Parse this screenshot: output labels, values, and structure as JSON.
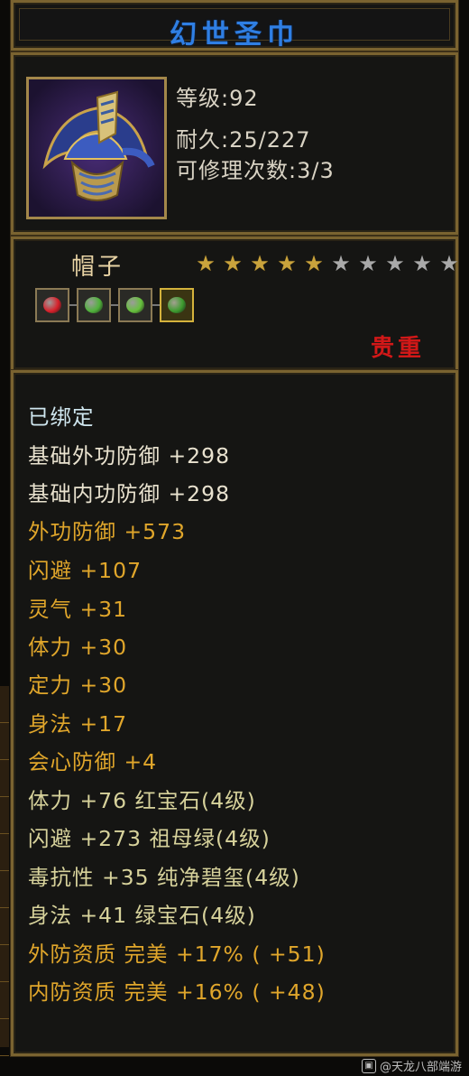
{
  "title": "幻世圣巾",
  "header": {
    "level": "等级:92",
    "durability": "耐久:25/227",
    "repair": "可修理次数:3/3"
  },
  "type_panel": {
    "item_type": "帽子",
    "stars_lit": 5,
    "stars_total": 10,
    "rarity": "贵重",
    "gems": [
      {
        "name": "red-gem-icon",
        "color": "#d8202a"
      },
      {
        "name": "green-gem-icon",
        "color": "#4fb23a"
      },
      {
        "name": "green-gem-icon",
        "color": "#66c03c"
      },
      {
        "name": "jade-gem-icon",
        "color": "#3d9b2e"
      }
    ]
  },
  "attributes": {
    "bound": "已绑定",
    "base_ext_def": "基础外功防御 +298",
    "base_int_def": "基础内功防御 +298",
    "ext_def": "外功防御 +573",
    "dodge": "闪避 +107",
    "spirit": "灵气 +31",
    "stamina": "体力 +30",
    "focus": "定力 +30",
    "agility": "身法 +17",
    "crit_def": "会心防御 +4",
    "gem1": "体力 +76 红宝石(4级)",
    "gem2": "闪避 +273 祖母绿(4级)",
    "gem3": "毒抗性 +35 纯净碧玺(4级)",
    "gem4": "身法 +41 绿宝石(4级)",
    "quality_ext": "外防资质 完美 +17% ( +51)",
    "quality_int": "内防资质 完美 +16% ( +48)"
  },
  "watermark": "@天龙八部端游"
}
